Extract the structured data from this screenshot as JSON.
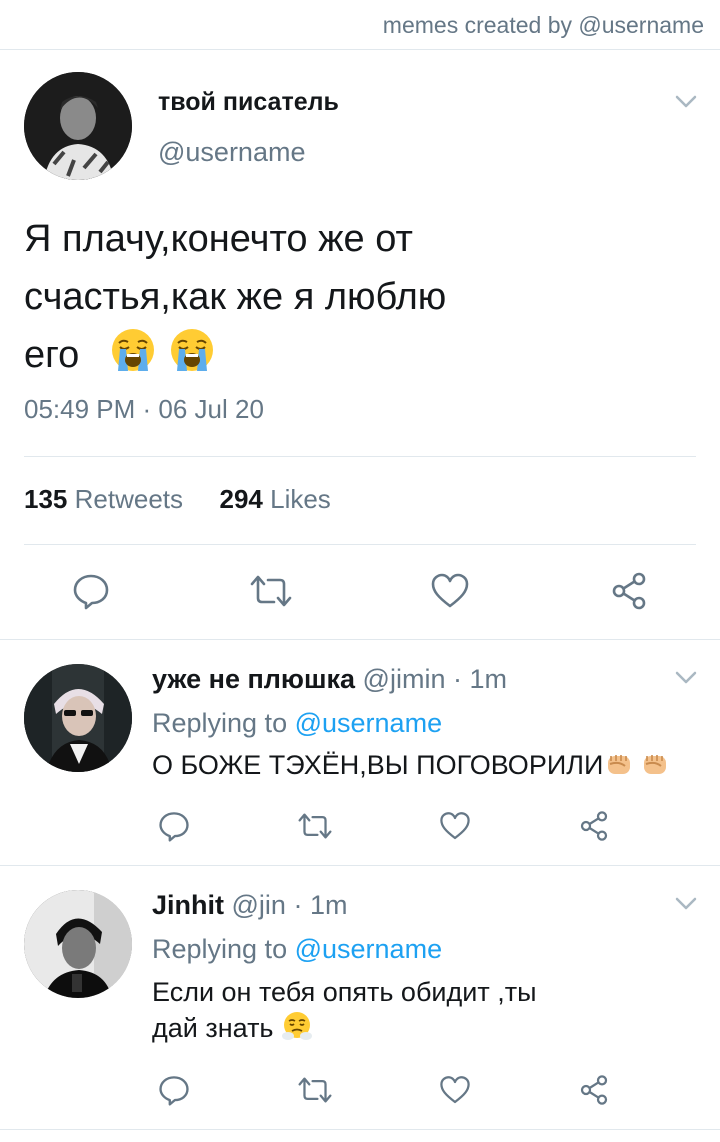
{
  "header": {
    "credit": "memes created by @username"
  },
  "main_tweet": {
    "display_name": "твой писатель",
    "handle": "@username",
    "text_line1": "Я плачу,конечто же от",
    "text_line2": "счастья,как же я люблю",
    "text_line3": "его",
    "emoji": "loudly-crying-face",
    "timestamp": "05:49 PM · 06 Jul 20",
    "retweets_count": "135",
    "retweets_label": "Retweets",
    "likes_count": "294",
    "likes_label": "Likes"
  },
  "replies": [
    {
      "display_name": "уже не плюшка",
      "handle": "@jimin",
      "time": "· 1m",
      "replying_prefix": "Replying to",
      "replying_handle": "@username",
      "text": "О БОЖЕ ТЭХЁН,ВЫ ПОГОВОРИЛИ",
      "emoji": "raised-fist"
    },
    {
      "display_name": "Jinhit",
      "handle": "@jin",
      "time": "· 1m",
      "replying_prefix": "Replying to",
      "replying_handle": "@username",
      "text_line1": "Если он тебя опять обидит ,ты",
      "text_line2": "дай знать",
      "emoji": "face-with-steam-from-nose"
    }
  ],
  "colors": {
    "text": "#14171a",
    "secondary": "#657786",
    "link": "#1da1f2",
    "divider": "#e1e8ed",
    "icon": "#657786"
  }
}
